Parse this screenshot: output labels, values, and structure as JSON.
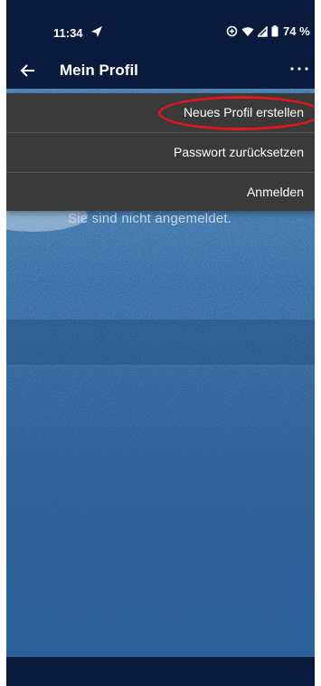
{
  "status_bar": {
    "time": "11:34",
    "battery": "74 %"
  },
  "app_bar": {
    "title": "Mein Profil"
  },
  "overflow_menu": {
    "items": [
      {
        "label": "Neues Profil erstellen"
      },
      {
        "label": "Passwort zurücksetzen"
      },
      {
        "label": "Anmelden"
      }
    ]
  },
  "content": {
    "message": "Sie sind nicht angemeldet."
  },
  "annotation": {
    "highlight_color": "#e0161b"
  },
  "colors": {
    "app_bar": "#0a1a3d",
    "menu_background": "#3a3a3a"
  }
}
